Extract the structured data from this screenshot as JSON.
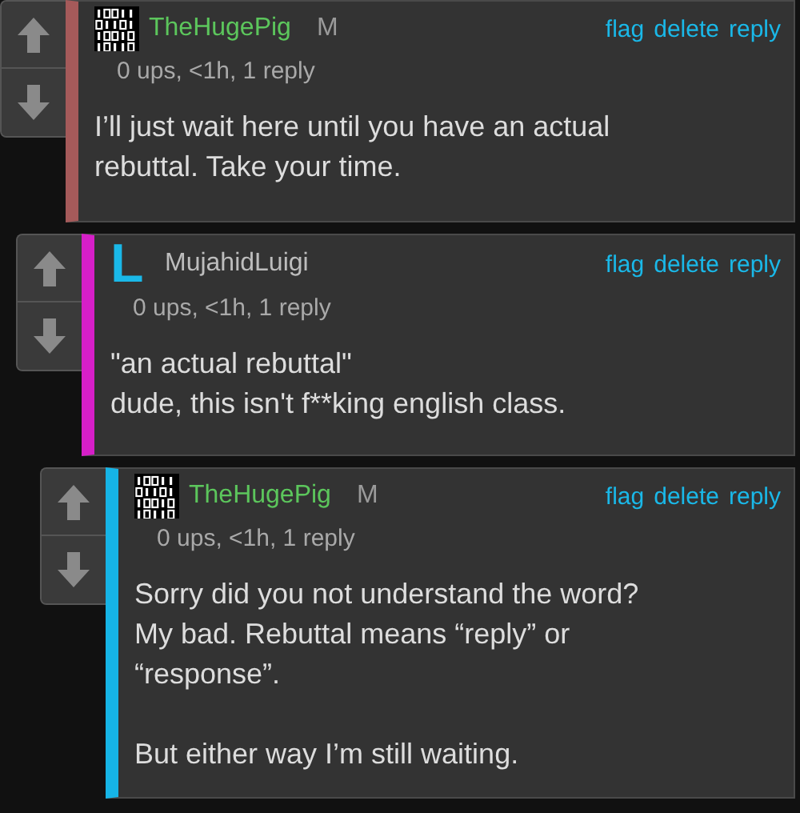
{
  "comments": [
    {
      "color": "#a55a5a",
      "avatar": {
        "kind": "binary"
      },
      "user": {
        "name": "TheHugePig",
        "color": "#5cc65c"
      },
      "badge": "M",
      "meta": "0 ups, <1h, 1 reply",
      "actions": [
        "flag",
        "delete",
        "reply"
      ],
      "text": "I’ll just wait here until you have an actual\nrebuttal. Take your time.",
      "children": [
        {
          "color": "#d61fc8",
          "avatar": {
            "kind": "letter",
            "letter": "L",
            "color": "#1ab8e8"
          },
          "user": {
            "name": "MujahidLuigi",
            "color": "#bdbdbd"
          },
          "meta": "0 ups, <1h, 1 reply",
          "actions": [
            "flag",
            "delete",
            "reply"
          ],
          "text": "\"an actual rebuttal\"\ndude, this isn't f**king english class.",
          "children": [
            {
              "color": "#16b4e6",
              "avatar": {
                "kind": "binary"
              },
              "user": {
                "name": "TheHugePig",
                "color": "#5cc65c"
              },
              "badge": "M",
              "meta": "0 ups, <1h, 1 reply",
              "actions": [
                "flag",
                "delete",
                "reply"
              ],
              "text": "Sorry did you not understand the word?\nMy bad. Rebuttal means “reply” or\n“response”.\n\nBut either way I’m still waiting."
            }
          ]
        }
      ]
    }
  ]
}
